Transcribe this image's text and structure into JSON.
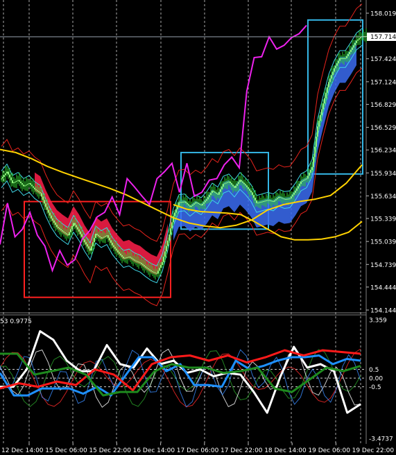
{
  "chart_data": [
    {
      "type": "candlestick",
      "panel": "main",
      "y_axis_ticks": [
        "158.019",
        "157.424",
        "157.124",
        "156.829",
        "156.529",
        "156.234",
        "155.934",
        "155.634",
        "155.339",
        "155.039",
        "154.739",
        "154.444",
        "154.144"
      ],
      "ylim": [
        154.144,
        158.019
      ],
      "current_price": "157.714",
      "x_axis_ticks": [
        "12 Dec 14:00",
        "15 Dec 06:00",
        "15 Dec 22:00",
        "16 Dec 14:00",
        "17 Dec 06:00",
        "17 Dec 22:00",
        "18 Dec 14:00",
        "19 Dec 06:00",
        "19 Dec 22:00"
      ],
      "grid": true,
      "highlight_boxes": [
        {
          "color": "#ff2020",
          "price_top": 155.56,
          "price_bottom": 154.31
        },
        {
          "color": "#35b7e6",
          "price_top": 156.2,
          "price_bottom": 155.2
        },
        {
          "color": "#35b7e6",
          "price_top": 157.93,
          "price_bottom": 155.92
        }
      ],
      "price_series": [
        155.86,
        155.95,
        155.8,
        155.84,
        155.76,
        155.8,
        155.72,
        155.67,
        155.49,
        155.34,
        155.23,
        155.17,
        155.12,
        155.28,
        155.17,
        155.03,
        154.92,
        155.14,
        155.08,
        155.12,
        154.99,
        154.9,
        154.82,
        154.84,
        154.79,
        154.76,
        154.7,
        154.65,
        154.62,
        154.77,
        155.05,
        155.37,
        155.55,
        155.56,
        155.49,
        155.55,
        155.51,
        155.59,
        155.7,
        155.65,
        155.79,
        155.82,
        155.74,
        155.84,
        155.77,
        155.68,
        155.54,
        155.56,
        155.58,
        155.56,
        155.62,
        155.59,
        155.6,
        155.7,
        155.82,
        155.86,
        156.01,
        156.54,
        156.84,
        157.12,
        157.3,
        157.43,
        157.43,
        157.54,
        157.66,
        157.72
      ],
      "overlays": [
        {
          "kind": "moving-average",
          "color": "#ffd200",
          "values": [
            156.24,
            156.2,
            156.12,
            156.02,
            155.94,
            155.87,
            155.8,
            155.73,
            155.65,
            155.55,
            155.45,
            155.35,
            155.28,
            155.24,
            155.22,
            155.25,
            155.32,
            155.45,
            155.52,
            155.56,
            155.59,
            155.64,
            155.8,
            156.04
          ]
        },
        {
          "kind": "moving-average",
          "color": "#ffd200",
          "values": [
            155.52,
            155.46,
            155.43,
            155.42,
            155.41,
            155.39,
            155.3,
            155.2,
            155.1,
            155.06,
            155.06,
            155.07,
            155.1,
            155.16,
            155.3
          ]
        },
        {
          "kind": "indicator",
          "color": "#ee22ee",
          "values": [
            155.0,
            155.54,
            155.1,
            155.2,
            155.42,
            155.12,
            154.98,
            154.66,
            154.92,
            154.73,
            154.8,
            155.07,
            155.18,
            155.36,
            155.42,
            155.62,
            155.39,
            155.86,
            155.75,
            155.63,
            155.52,
            155.86,
            155.95,
            156.06,
            155.68,
            156.06,
            155.63,
            155.68,
            155.84,
            155.86,
            156.04,
            156.14,
            156.0,
            157.0,
            157.44,
            157.45,
            157.71,
            157.55,
            157.6,
            157.7,
            157.75,
            157.86
          ]
        }
      ]
    },
    {
      "type": "line",
      "panel": "oscillator",
      "label": "53 0.9775",
      "y_axis_ticks": [
        "3.359",
        "0.5",
        "0.00",
        "-0.5",
        "-3.4737"
      ],
      "ylim": [
        -3.4737,
        3.359
      ],
      "series": [
        {
          "color": "#ffffff",
          "width": 3,
          "values": [
            -0.5,
            -0.5,
            0.5,
            2.7,
            2.2,
            1.0,
            0.4,
            0.4,
            1.9,
            0.8,
            0.6,
            1.7,
            0.8,
            1.0,
            0.3,
            0.5,
            0.1,
            0.3,
            0.2,
            -0.8,
            -2.0,
            0.1,
            1.8,
            0.6,
            0.8,
            0.4,
            -2.0,
            -1.5
          ]
        },
        {
          "color": "#1e90ff",
          "width": 3,
          "values": [
            0.3,
            -1.0,
            -1.0,
            -0.6,
            -0.6,
            -0.6,
            -0.9,
            -0.5,
            -1.0,
            0.1,
            1.2,
            1.2,
            0.4,
            0.8,
            -0.4,
            -0.4,
            -0.5,
            1.0,
            0.5,
            0.7,
            1.0,
            1.2,
            1.2,
            1.3,
            0.8,
            1.1,
            1.0
          ]
        },
        {
          "color": "#ff1a1a",
          "width": 3,
          "values": [
            -0.6,
            -0.3,
            -0.5,
            -0.2,
            -0.4,
            0.5,
            0.2,
            -0.7,
            0.8,
            1.2,
            1.3,
            1.0,
            1.3,
            0.9,
            1.2,
            1.6,
            1.3,
            1.6,
            1.5,
            1.4
          ]
        },
        {
          "color": "#1e8a1e",
          "width": 3,
          "values": [
            1.4,
            1.4,
            0.2,
            0.4,
            0.6,
            0.2,
            -1.0,
            -0.8,
            -0.8,
            0.4,
            0.8,
            0.6,
            0.6,
            0.3,
            0.4,
            0.6,
            -0.6,
            -0.8,
            -0.1,
            0.6,
            0.4,
            0.7
          ]
        }
      ]
    }
  ]
}
